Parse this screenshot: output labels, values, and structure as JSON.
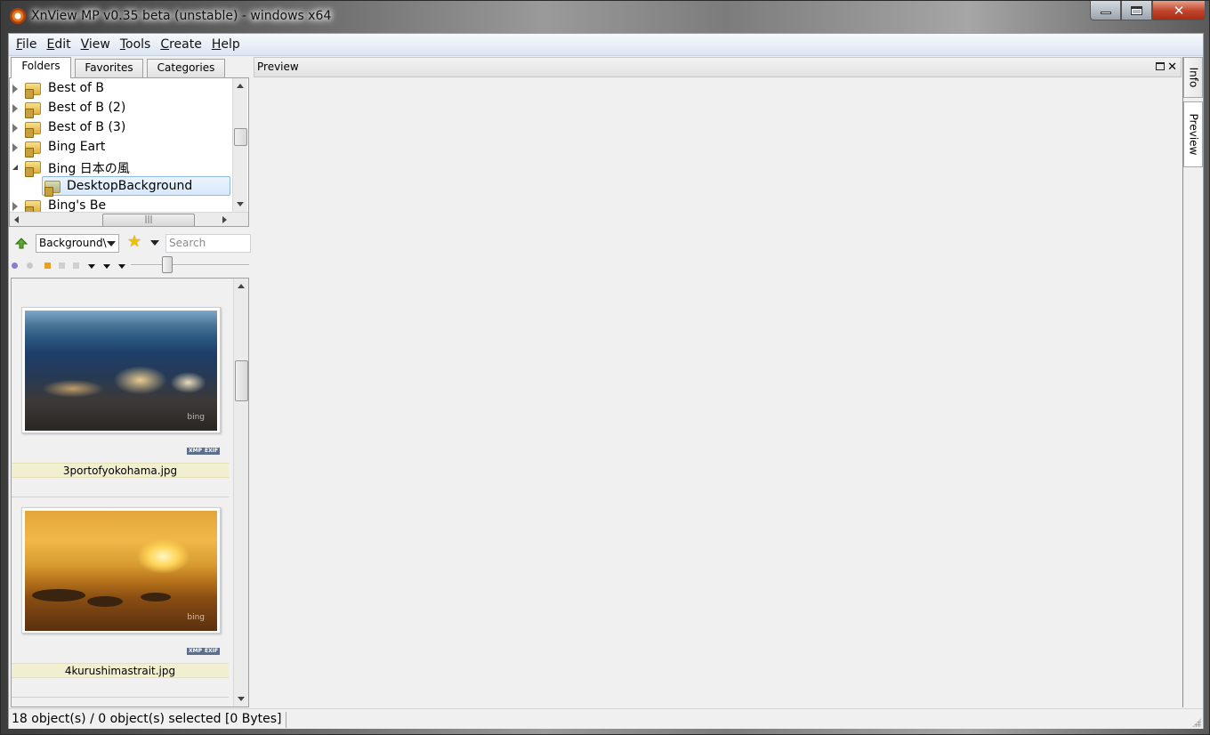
{
  "window": {
    "title": "XnView MP v0.35 beta (unstable) - windows x64"
  },
  "menu": {
    "items": [
      {
        "label": "File",
        "underline": "F",
        "rest": "ile"
      },
      {
        "label": "Edit",
        "underline": "E",
        "rest": "dit"
      },
      {
        "label": "View",
        "underline": "V",
        "rest": "iew"
      },
      {
        "label": "Tools",
        "underline": "T",
        "rest": "ools"
      },
      {
        "label": "Create",
        "underline": "C",
        "rest": "reate"
      },
      {
        "label": "Help",
        "underline": "H",
        "rest": "elp"
      }
    ]
  },
  "left_tabs": [
    "Folders",
    "Favorites",
    "Categories"
  ],
  "folder_tree": {
    "items": [
      {
        "label": "Best of B",
        "expanded": false
      },
      {
        "label": "Best of B (2)",
        "expanded": false
      },
      {
        "label": "Best of B (3)",
        "expanded": false
      },
      {
        "label": "Bing Eart",
        "expanded": false
      },
      {
        "label": "Bing 日本の風",
        "expanded": true
      },
      {
        "label": "DesktopBackground",
        "selected": true
      },
      {
        "label": "Bing's Be",
        "expanded": false
      }
    ]
  },
  "toolbar": {
    "path_value": "Background\\",
    "search_placeholder": "Search"
  },
  "thumbnails": [
    {
      "filename": "3portofyokohama.jpg",
      "watermark": "bing",
      "badges": [
        "XMP",
        "EXIF"
      ]
    },
    {
      "filename": "4kurushimastrait.jpg",
      "watermark": "bing",
      "badges": [
        "XMP",
        "EXIF"
      ]
    }
  ],
  "preview_panel": {
    "title": "Preview"
  },
  "side_tabs": [
    "Info",
    "Preview"
  ],
  "statusbar": {
    "text": "18 object(s) / 0 object(s) selected [0 Bytes]"
  },
  "colors": {
    "selection_fill": "#d6e8fb",
    "filename_bar": "#f1efcf",
    "close_button": "#c0432a"
  }
}
